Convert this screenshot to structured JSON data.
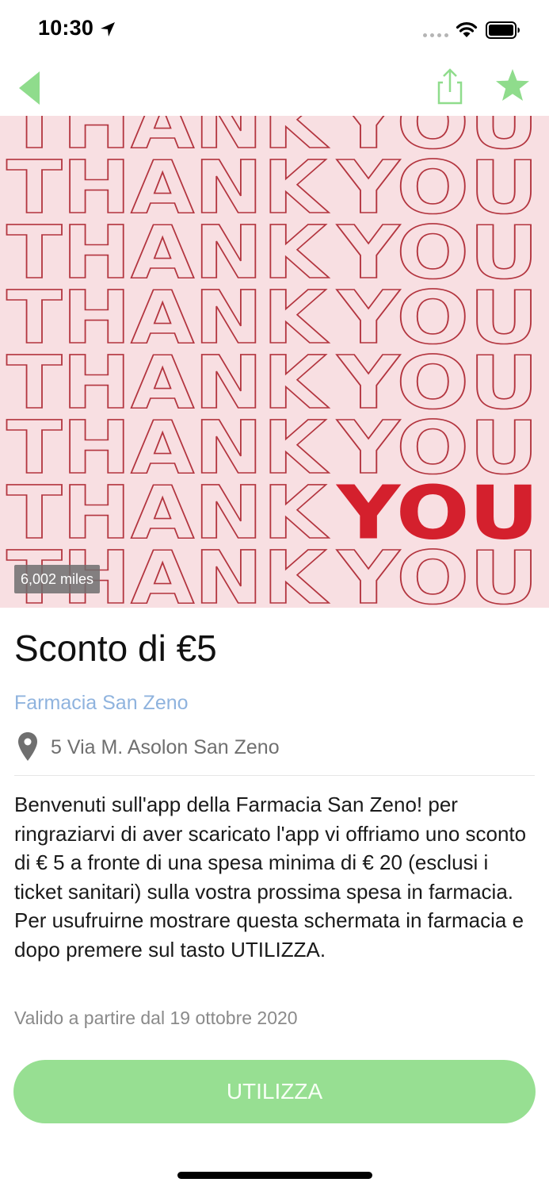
{
  "status_bar": {
    "time": "10:30"
  },
  "nav": {
    "back_icon": "chevron-left-icon",
    "share_icon": "share-icon",
    "favorite_icon": "star-icon",
    "accent_color": "#8fdc8c"
  },
  "hero": {
    "text_line": "THANK YOU",
    "highlight_word": "YOU",
    "background_color": "#f8dfe2",
    "outline_color": "#b3353f",
    "highlight_color": "#d4202d",
    "distance": "6,002 miles"
  },
  "offer": {
    "title": "Sconto di €5",
    "store_name": "Farmacia San Zeno",
    "address": "5 Via M. Asolon San Zeno",
    "description": "Benvenuti sull'app della Farmacia San Zeno! per ringraziarvi di aver scaricato l'app vi offriamo uno sconto di € 5 a fronte di una spesa minima di € 20 (esclusi i ticket sanitari) sulla vostra prossima spesa in farmacia. Per usufruirne mostrare questa schermata in farmacia e dopo premere sul tasto UTILIZZA.",
    "valid_from": "Valido a partire dal 19 ottobre 2020",
    "use_button_label": "UTILIZZA"
  }
}
